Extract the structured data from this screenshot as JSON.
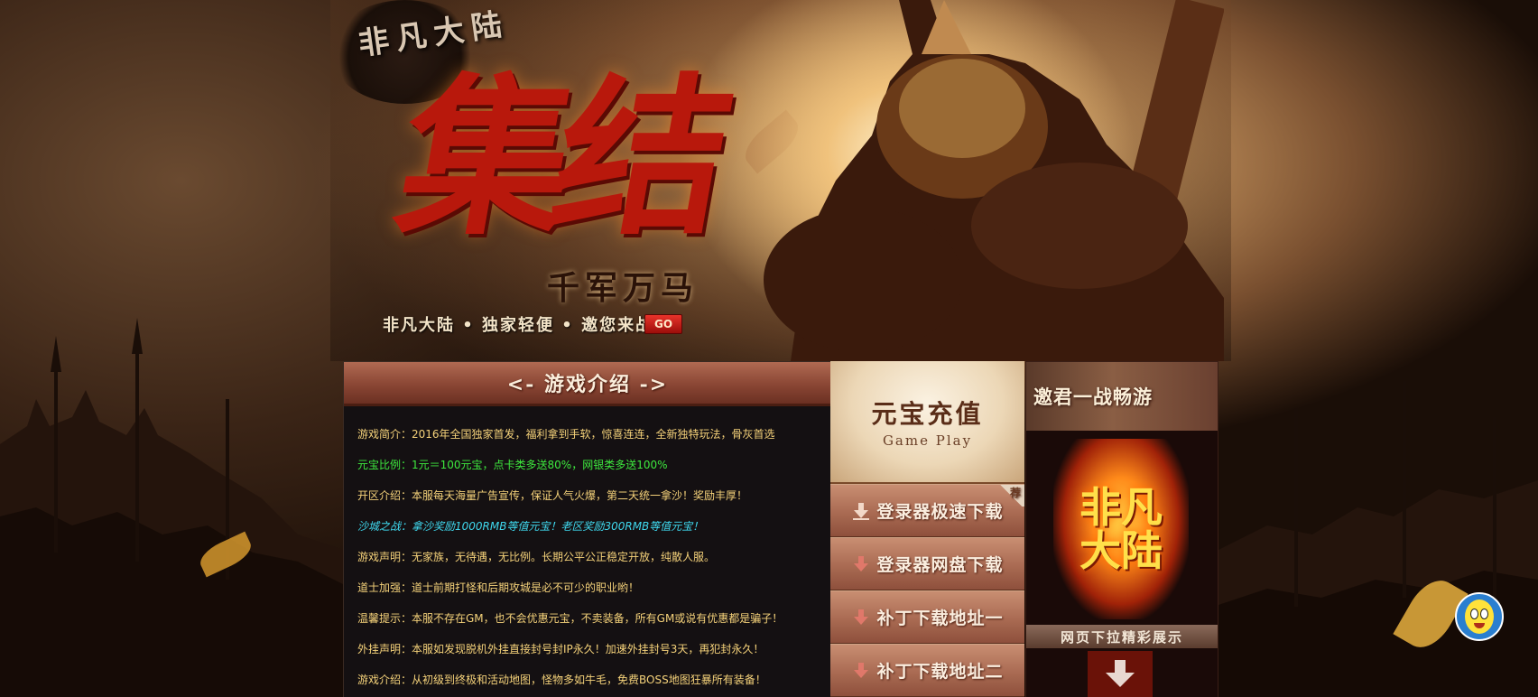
{
  "hero": {
    "logo_text": "非凡大陆",
    "big_title": "集结",
    "sub_title": "千军万马",
    "tagline": "非凡大陆 • 独家轻便 • 邀您来战",
    "go_label": "GO"
  },
  "intro": {
    "header": "<- 游戏介绍 ->",
    "items": [
      {
        "text": "游戏简介：2016年全国独家首发，福利拿到手软，惊喜连连，全新独特玩法，骨灰首选",
        "color": "#f5d27a"
      },
      {
        "text": "元宝比例：1元＝100元宝，点卡类多送80%，网银类多送100%",
        "color": "#3ee83e"
      },
      {
        "text": "开区介绍：本服每天海量广告宣传，保证人气火爆，第二天统一拿沙！奖励丰厚！",
        "color": "#f5d27a"
      },
      {
        "text": "沙城之战：拿沙奖励1000RMB等值元宝！老区奖励300RMB等值元宝！",
        "color": "#3fd8ee"
      },
      {
        "text": "游戏声明：无家族，无待遇，无比例。长期公平公正稳定开放，纯散人服。",
        "color": "#f5d27a"
      },
      {
        "text": "道士加强：道士前期打怪和后期攻城是必不可少的职业哟！",
        "color": "#f5d27a"
      },
      {
        "text": "温馨提示：本服不存在GM，也不会优惠元宝，不卖装备，所有GM或说有优惠都是骗子！",
        "color": "#f5d27a"
      },
      {
        "text": "外挂声明：本服如发现脱机外挂直接封号封IP永久！加速外挂封号3天，再犯封永久！",
        "color": "#f5d27a"
      },
      {
        "text": "游戏介绍：从初级到终极和活动地图，怪物多如牛毛，免费BOSS地图狂暴所有装备！",
        "color": "#f5d27a"
      }
    ]
  },
  "recharge": {
    "title": "元宝充值",
    "subtitle": "Game Play",
    "badge": "荐",
    "buttons": [
      {
        "label": "登录器极速下载",
        "icon": "download-arrow-icon"
      },
      {
        "label": "登录器网盘下载",
        "icon": "download-arrow-icon"
      },
      {
        "label": "补丁下载地址一",
        "icon": "download-arrow-icon"
      },
      {
        "label": "补丁下载地址二",
        "icon": "download-arrow-icon"
      }
    ]
  },
  "promo": {
    "header": "邀君一战畅游",
    "flame_text": "非凡大陆",
    "band": "网页下拉精彩展示"
  },
  "colors": {
    "accent_red": "#b8180c",
    "header_brown": "#8a4634",
    "text_yellow": "#f5d27a",
    "text_green": "#3ee83e",
    "text_cyan": "#3fd8ee"
  }
}
